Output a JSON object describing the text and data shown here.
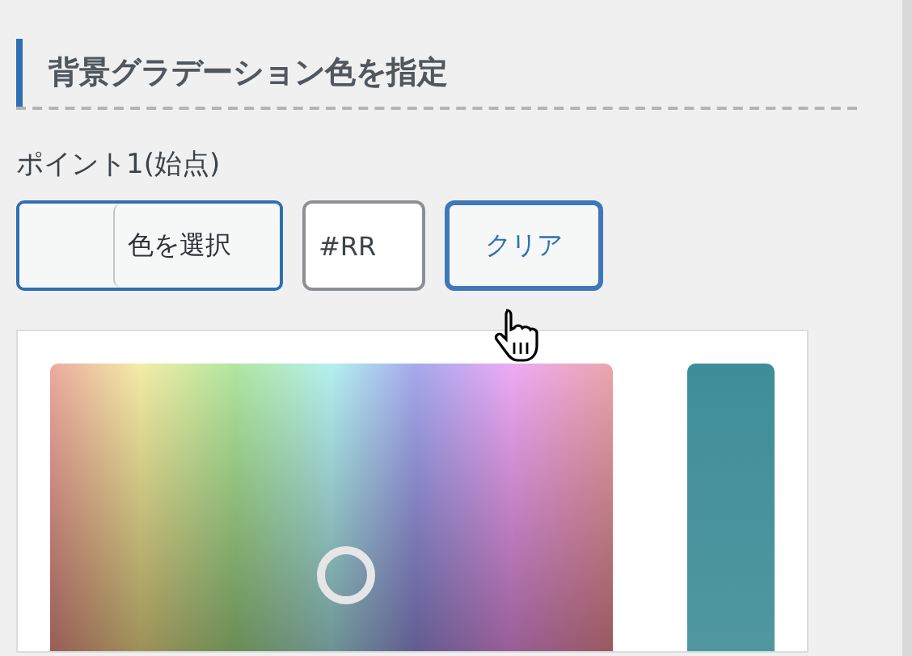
{
  "section_title": "背景グラデーション色を指定",
  "point_label": "ポイント1(始点)",
  "color_button": {
    "label": "色を選択"
  },
  "hex_field": {
    "placeholder": "#RR"
  },
  "clear_button": {
    "label": "クリア",
    "focused": true
  }
}
